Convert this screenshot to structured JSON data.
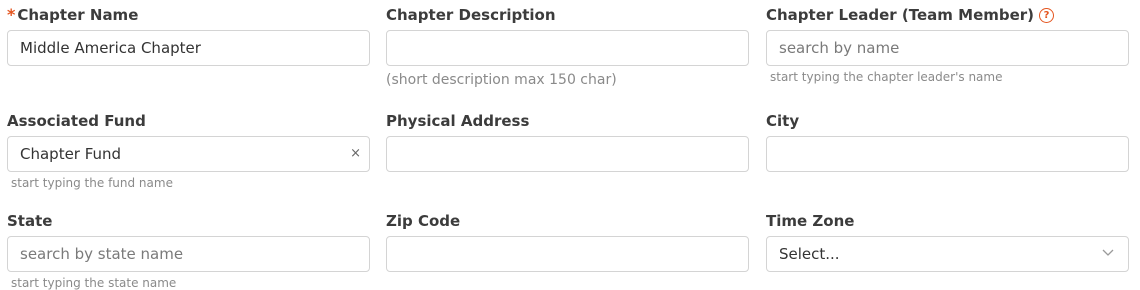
{
  "fields": {
    "chapter_name": {
      "label": "Chapter Name",
      "required_marker": "*",
      "value": "Middle America Chapter"
    },
    "chapter_description": {
      "label": "Chapter Description",
      "value": "",
      "hint": "(short description max 150 char)"
    },
    "chapter_leader": {
      "label": "Chapter Leader (Team Member)",
      "help_icon": "?",
      "placeholder": "search by name",
      "hint": "start typing the chapter leader's name"
    },
    "associated_fund": {
      "label": "Associated Fund",
      "value": "Chapter Fund",
      "clear_icon": "×",
      "hint": "start typing the fund name"
    },
    "physical_address": {
      "label": "Physical Address",
      "value": ""
    },
    "city": {
      "label": "City",
      "value": ""
    },
    "state": {
      "label": "State",
      "placeholder": "search by state name",
      "hint": "start typing the state name"
    },
    "zip_code": {
      "label": "Zip Code",
      "value": ""
    },
    "time_zone": {
      "label": "Time Zone",
      "selected": "Select..."
    }
  },
  "colors": {
    "accent": "#e4551f",
    "border": "#d4d4d4",
    "hint": "#8a8a8a"
  }
}
